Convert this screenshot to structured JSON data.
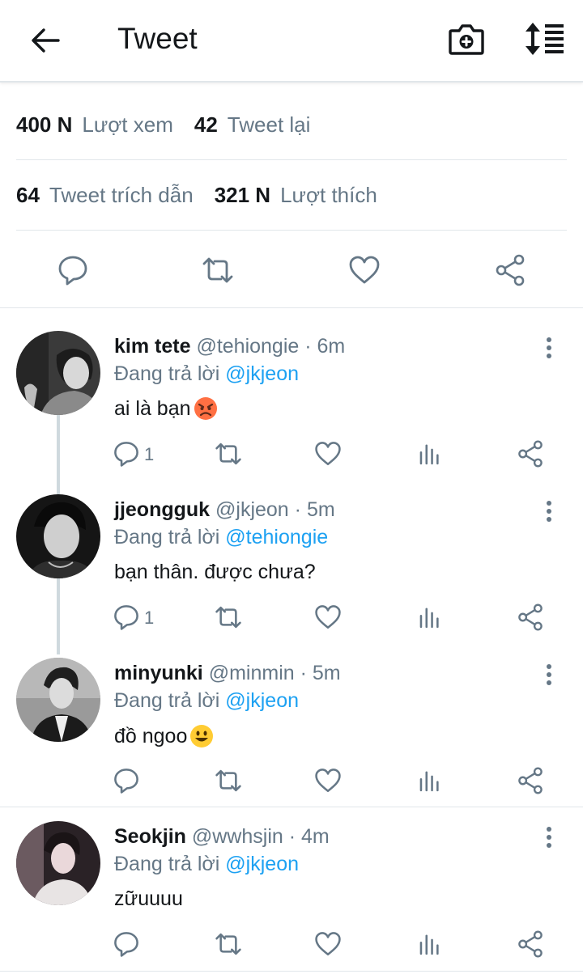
{
  "header": {
    "title": "Tweet",
    "back_icon": "arrow-left-icon",
    "camera_icon": "camera-add-icon",
    "sort_icon": "sort-list-icon"
  },
  "stats": {
    "views_num": "400 N",
    "views_label": "Lượt xem",
    "retweets_num": "42",
    "retweets_label": "Tweet lại",
    "quotes_num": "64",
    "quotes_label": "Tweet trích dẫn",
    "likes_num": "321 N",
    "likes_label": "Lượt thích"
  },
  "colors": {
    "accent": "#1da1f2",
    "secondary_text": "#657786",
    "icon": "#657786",
    "divider": "#e1e6ea"
  },
  "replies": [
    {
      "name": "kim tete",
      "handle": "@tehiongie",
      "sep": "·",
      "time": "6m",
      "replying_label": "Đang trả lời",
      "mention": "@jkjeon",
      "text": "ai là bạn",
      "emoji": "angry-face",
      "reply_count": "1"
    },
    {
      "name": "jjeongguk",
      "handle": "@jkjeon",
      "sep": "·",
      "time": "5m",
      "replying_label": "Đang trả lời",
      "mention": "@tehiongie",
      "text": "bạn thân. được chưa?",
      "emoji": "",
      "reply_count": "1"
    },
    {
      "name": "minyunki",
      "handle": "@minmin",
      "sep": "·",
      "time": "5m",
      "replying_label": "Đang trả lời",
      "mention": "@jkjeon",
      "text": "đồ ngoo",
      "emoji": "smiling-face",
      "reply_count": ""
    },
    {
      "name": "Seokjin",
      "handle": "@wwhsjin",
      "sep": "·",
      "time": "4m",
      "replying_label": "Đang trả lời",
      "mention": "@jkjeon",
      "text": "zữuuuu",
      "emoji": "",
      "reply_count": ""
    }
  ]
}
